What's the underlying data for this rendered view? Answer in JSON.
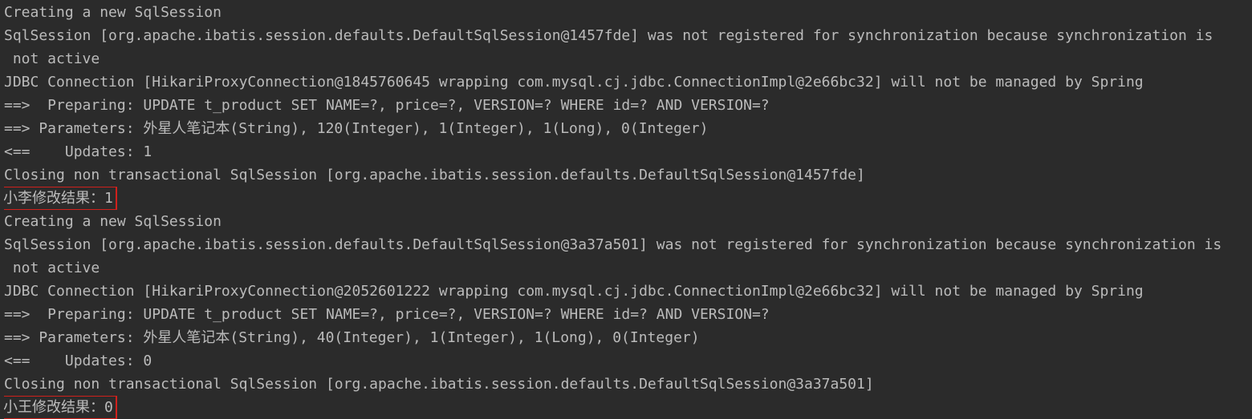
{
  "console": {
    "lines": [
      "Creating a new SqlSession",
      "SqlSession [org.apache.ibatis.session.defaults.DefaultSqlSession@1457fde] was not registered for synchronization because synchronization is",
      " not active",
      "JDBC Connection [HikariProxyConnection@1845760645 wrapping com.mysql.cj.jdbc.ConnectionImpl@2e66bc32] will not be managed by Spring",
      "==>  Preparing: UPDATE t_product SET NAME=?, price=?, VERSION=? WHERE id=? AND VERSION=?",
      "==> Parameters: 外星人笔记本(String), 120(Integer), 1(Integer), 1(Long), 0(Integer)",
      "<==    Updates: 1",
      "Closing non transactional SqlSession [org.apache.ibatis.session.defaults.DefaultSqlSession@1457fde]",
      "小李修改结果：1",
      "Creating a new SqlSession",
      "SqlSession [org.apache.ibatis.session.defaults.DefaultSqlSession@3a37a501] was not registered for synchronization because synchronization is",
      " not active",
      "JDBC Connection [HikariProxyConnection@2052601222 wrapping com.mysql.cj.jdbc.ConnectionImpl@2e66bc32] will not be managed by Spring",
      "==>  Preparing: UPDATE t_product SET NAME=?, price=?, VERSION=? WHERE id=? AND VERSION=?",
      "==> Parameters: 外星人笔记本(String), 40(Integer), 1(Integer), 1(Long), 0(Integer)",
      "<==    Updates: 0",
      "Closing non transactional SqlSession [org.apache.ibatis.session.defaults.DefaultSqlSession@3a37a501]",
      "小王修改结果：0"
    ],
    "highlight_color": "#d0211c",
    "text_color": "#bbbbbb",
    "background_color": "#2b2b2b"
  }
}
